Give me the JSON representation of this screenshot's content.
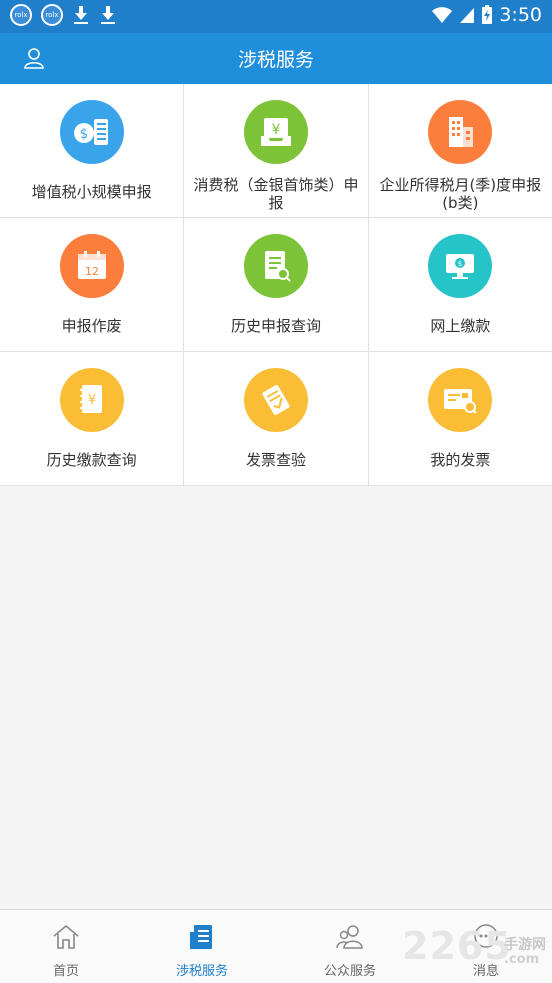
{
  "status_bar": {
    "time": "3:50",
    "app_badge_text": "rolx"
  },
  "app_bar": {
    "title": "涉税服务"
  },
  "services": [
    {
      "label": "增值税小规模申报",
      "icon": "coin-stack-icon",
      "color": "#3aa4ea"
    },
    {
      "label": "消费税（金银首饰类）申报",
      "icon": "yen-box-icon",
      "color": "#7cc338"
    },
    {
      "label": "企业所得税月(季)度申报(b类)",
      "icon": "building-icon",
      "color": "#fb7e3d"
    },
    {
      "label": "申报作废",
      "icon": "calendar-icon",
      "color": "#fb7e3d"
    },
    {
      "label": "历史申报查询",
      "icon": "document-search-icon",
      "color": "#7cc338"
    },
    {
      "label": "网上缴款",
      "icon": "monitor-yen-icon",
      "color": "#26c3c8"
    },
    {
      "label": "历史缴款查询",
      "icon": "yen-notebook-icon",
      "color": "#fbbd36"
    },
    {
      "label": "发票查验",
      "icon": "ticket-check-icon",
      "color": "#fbbd36"
    },
    {
      "label": "我的发票",
      "icon": "invoice-card-icon",
      "color": "#fbbd36"
    }
  ],
  "tabs": [
    {
      "label": "首页",
      "icon": "home-icon",
      "active": false
    },
    {
      "label": "涉税服务",
      "icon": "document-list-icon",
      "active": true
    },
    {
      "label": "公众服务",
      "icon": "users-icon",
      "active": false
    },
    {
      "label": "消息",
      "icon": "chat-icon",
      "active": false
    }
  ],
  "watermark": {
    "number": "2265",
    "text": "手游网",
    "domain": ".com"
  }
}
